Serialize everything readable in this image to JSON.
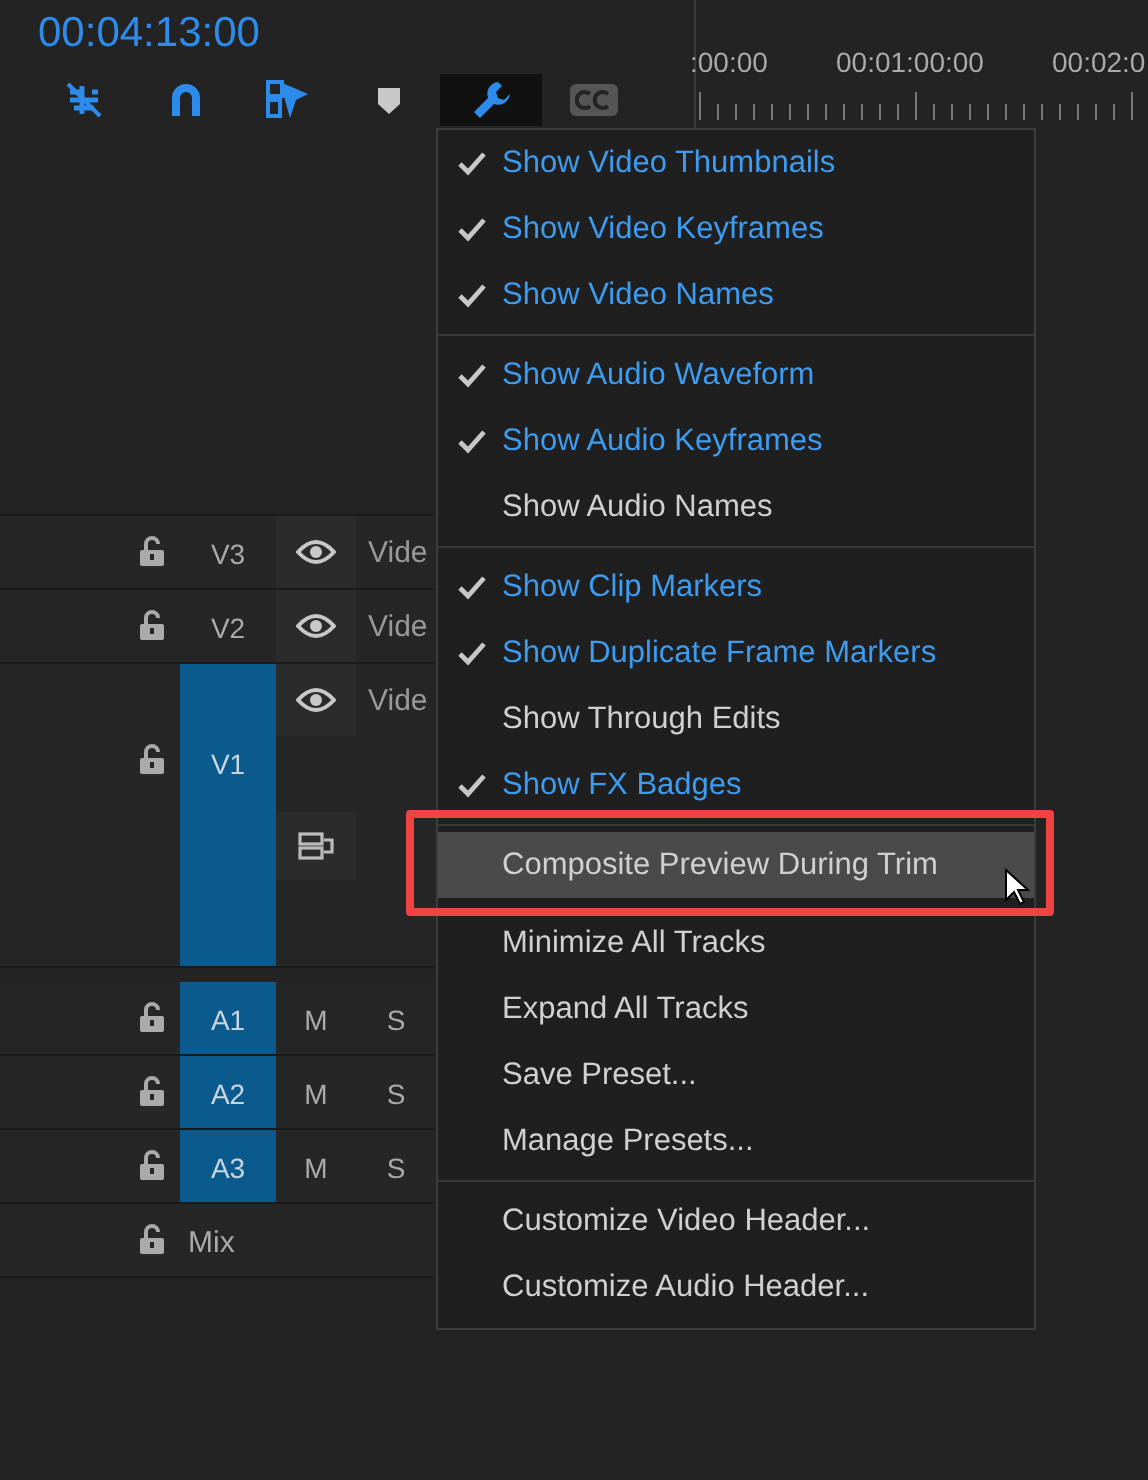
{
  "timecode": "00:04:13:00",
  "ruler": {
    "labels": [
      ":00:00",
      "00:01:00:00",
      "00:02:0"
    ]
  },
  "tracks": [
    {
      "kind": "video",
      "label": "V3",
      "targeted": false,
      "expanded": false,
      "name": "Vide"
    },
    {
      "kind": "video",
      "label": "V2",
      "targeted": false,
      "expanded": false,
      "name": "Vide"
    },
    {
      "kind": "video",
      "label": "V1",
      "targeted": true,
      "expanded": true,
      "name": "Vide"
    },
    {
      "kind": "audio",
      "label": "A1",
      "targeted": true,
      "mute": "M",
      "solo": "S"
    },
    {
      "kind": "audio",
      "label": "A2",
      "targeted": true,
      "mute": "M",
      "solo": "S"
    },
    {
      "kind": "audio",
      "label": "A3",
      "targeted": true,
      "mute": "M",
      "solo": "S"
    },
    {
      "kind": "mix",
      "label": "Mix"
    }
  ],
  "menu": {
    "groups": [
      [
        {
          "label": "Show Video Thumbnails",
          "checked": true,
          "highlighted": false
        },
        {
          "label": "Show Video Keyframes",
          "checked": true,
          "highlighted": false
        },
        {
          "label": "Show Video Names",
          "checked": true,
          "highlighted": false
        }
      ],
      [
        {
          "label": "Show Audio Waveform",
          "checked": true,
          "highlighted": false
        },
        {
          "label": "Show Audio Keyframes",
          "checked": true,
          "highlighted": false
        },
        {
          "label": "Show Audio Names",
          "checked": false,
          "highlighted": false
        }
      ],
      [
        {
          "label": "Show Clip Markers",
          "checked": true,
          "highlighted": false
        },
        {
          "label": "Show Duplicate Frame Markers",
          "checked": true,
          "highlighted": false
        },
        {
          "label": "Show Through Edits",
          "checked": false,
          "highlighted": false
        },
        {
          "label": "Show FX Badges",
          "checked": true,
          "highlighted": false
        }
      ],
      [
        {
          "label": "Composite Preview During Trim",
          "checked": false,
          "highlighted": true
        },
        {
          "label": "Minimize All Tracks",
          "checked": false,
          "highlighted": false
        },
        {
          "label": "Expand All Tracks",
          "checked": false,
          "highlighted": false
        },
        {
          "label": "Save Preset...",
          "checked": false,
          "highlighted": false
        },
        {
          "label": "Manage Presets...",
          "checked": false,
          "highlighted": false
        }
      ],
      [
        {
          "label": "Customize Video Header...",
          "checked": false,
          "highlighted": false
        },
        {
          "label": "Customize Audio Header...",
          "checked": false,
          "highlighted": false
        }
      ]
    ]
  }
}
